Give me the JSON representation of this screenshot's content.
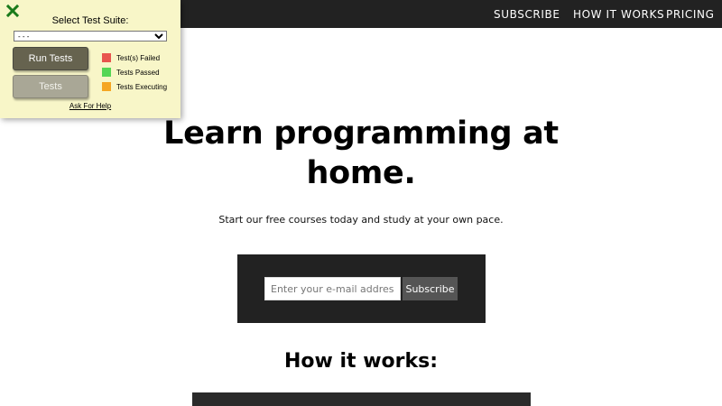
{
  "nav": {
    "links": [
      {
        "label": "SUBSCRIBE"
      },
      {
        "label": "HOW IT WORKS"
      },
      {
        "label": "PRICING"
      }
    ]
  },
  "hero": {
    "title": "Learn programming at home.",
    "subtitle": "Start our free courses today and study at your own pace."
  },
  "signup": {
    "email_placeholder": "Enter your e-mail address...",
    "email_value": "",
    "button_label": "Subscribe"
  },
  "how": {
    "heading": "How it works:"
  },
  "test_panel": {
    "close_icon": "close-icon",
    "title": "Select Test Suite:",
    "suite_options": [
      "- - -"
    ],
    "suite_selected": "- - -",
    "run_button_label": "Run Tests",
    "tests_button_label": "Tests",
    "legend": [
      {
        "label": "Test(s) Failed",
        "color": "#e8554e"
      },
      {
        "label": "Tests Passed",
        "color": "#55d655"
      },
      {
        "label": "Tests Executing",
        "color": "#f5a623"
      }
    ],
    "help_link_label": "Ask For Help",
    "close_icon_color": "#1a7a1a"
  },
  "colors": {
    "topbar": "#222222",
    "panel_bg": "#f8f6c8",
    "signup_bg": "#222222",
    "subscribe_button": "#555555"
  }
}
